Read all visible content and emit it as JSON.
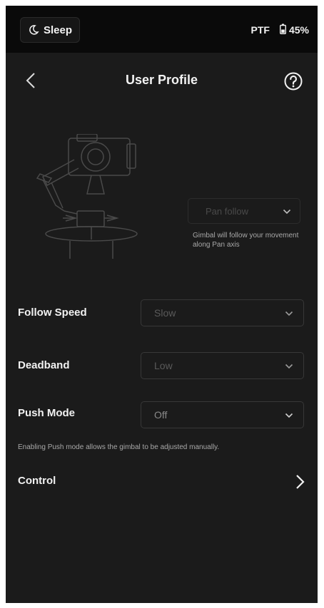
{
  "status_bar": {
    "sleep_label": "Sleep",
    "mode": "PTF",
    "battery": "45%"
  },
  "header": {
    "title": "User Profile"
  },
  "follow_mode": {
    "selected": "Pan follow",
    "description": "Gimbal will follow your movement along Pan axis"
  },
  "settings": {
    "follow_speed": {
      "label": "Follow Speed",
      "value": "Slow"
    },
    "deadband": {
      "label": "Deadband",
      "value": "Low"
    },
    "push_mode": {
      "label": "Push Mode",
      "value": "Off"
    },
    "push_note": "Enabling Push mode allows the gimbal to be adjusted manually."
  },
  "control": {
    "label": "Control"
  },
  "icons": {
    "sleep": "moon-icon",
    "battery": "battery-icon",
    "back": "chevron-left-icon",
    "help": "help-circle-icon",
    "dropdown": "chevron-down-icon",
    "control": "chevron-right-icon"
  },
  "colors": {
    "background": "#1b1b1b",
    "status_bar": "#0a0a0a",
    "text": "#f2f2f2",
    "muted": "#a8a8a8"
  }
}
